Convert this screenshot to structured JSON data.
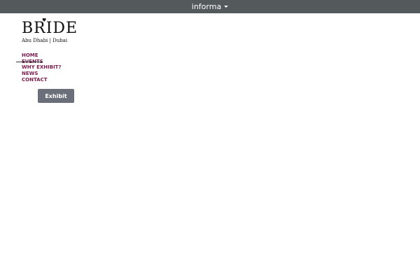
{
  "topbar": {
    "brand": "informa",
    "background": "#545a5c"
  },
  "logo": {
    "wordmark": "BRIDE",
    "subtitle": "Abu Dhabi | Dubai",
    "heart_icon": "heart-icon"
  },
  "nav": {
    "items": [
      {
        "label": "HOME"
      },
      {
        "label": "EVENTS"
      },
      {
        "label": "WHY EXHIBIT?"
      },
      {
        "label": "NEWS"
      },
      {
        "label": "CONTACT"
      }
    ],
    "color": "#7a1b4c"
  },
  "cta": {
    "label": "Exhibit",
    "background": "#6a6f7a"
  }
}
